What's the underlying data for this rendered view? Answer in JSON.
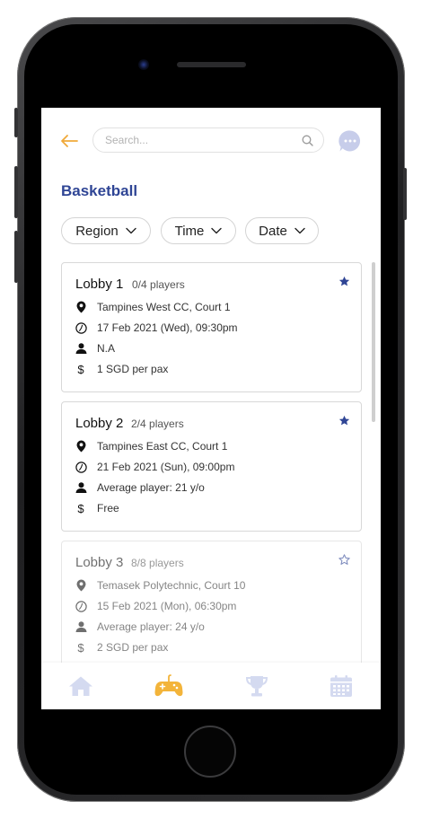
{
  "header": {
    "search_placeholder": "Search..."
  },
  "page": {
    "title": "Basketball"
  },
  "filters": [
    {
      "label": "Region"
    },
    {
      "label": "Time"
    },
    {
      "label": "Date"
    }
  ],
  "lobbies": [
    {
      "name": "Lobby 1",
      "players": "0/4 players",
      "location": "Tampines West CC, Court 1",
      "datetime": "17 Feb 2021 (Wed), 09:30pm",
      "age": "N.A",
      "price": "1 SGD per pax",
      "starred": true
    },
    {
      "name": "Lobby 2",
      "players": "2/4 players",
      "location": "Tampines East CC, Court 1",
      "datetime": "21 Feb 2021 (Sun), 09:00pm",
      "age": "Average player: 21 y/o",
      "price": "Free",
      "starred": true
    },
    {
      "name": "Lobby 3",
      "players": "8/8 players",
      "location": "Temasek Polytechnic, Court 10",
      "datetime": "15 Feb 2021 (Mon), 06:30pm",
      "age": "Average player: 24 y/o",
      "price": "2 SGD per pax",
      "starred": false,
      "full": true
    }
  ],
  "bottom_nav": {
    "items": [
      {
        "icon": "home-icon",
        "active": false
      },
      {
        "icon": "gamepad-icon",
        "active": true
      },
      {
        "icon": "trophy-icon",
        "active": false
      },
      {
        "icon": "calendar-icon",
        "active": false
      }
    ]
  },
  "colors": {
    "accent": "#2f4595",
    "back_arrow": "#f0a93a",
    "nav_active": "#f3b43a",
    "nav_inactive": "#d4daf0",
    "chat_bubble": "#c7cdea"
  }
}
